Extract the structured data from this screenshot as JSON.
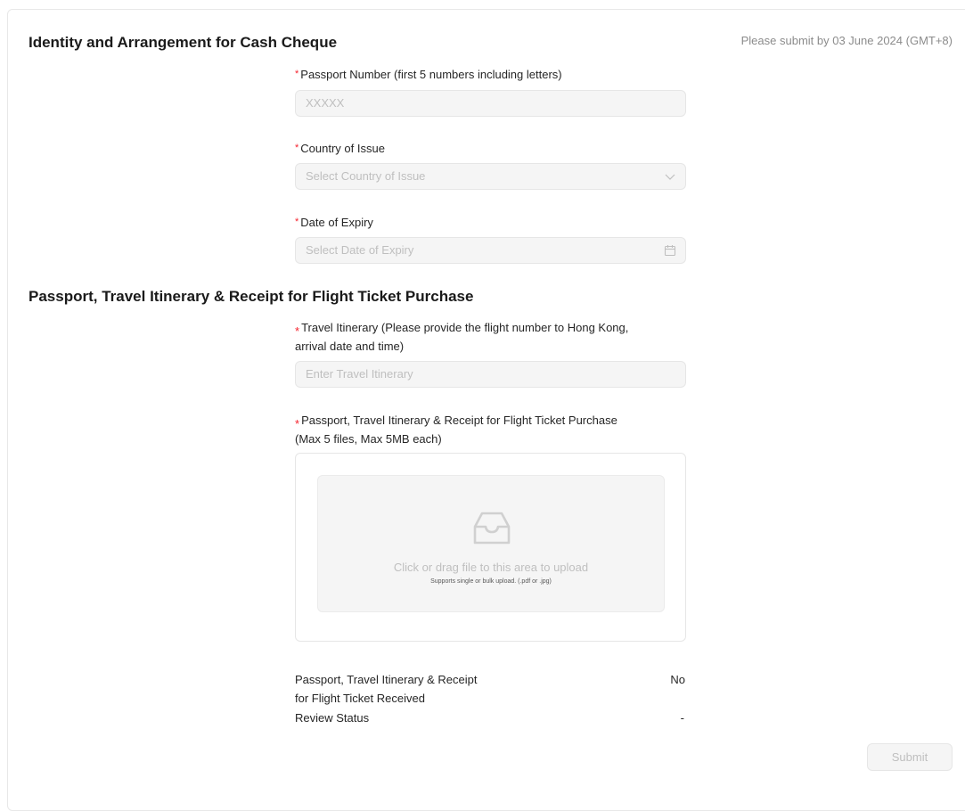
{
  "deadline": "Please submit by 03 June 2024 (GMT+8)",
  "section1": {
    "title": "Identity and Arrangement for Cash Cheque",
    "passport": {
      "label": "Passport Number (first 5 numbers including letters)",
      "placeholder": "XXXXX"
    },
    "country": {
      "label": "Country of Issue",
      "placeholder": "Select Country of Issue"
    },
    "expiry": {
      "label": "Date of Expiry",
      "placeholder": "Select Date of Expiry"
    }
  },
  "section2": {
    "title": "Passport, Travel Itinerary & Receipt for Flight Ticket Purchase",
    "itinerary": {
      "label_line1": "Travel Itinerary (Please provide the flight number to Hong Kong,",
      "label_line2": "arrival date and time)",
      "placeholder": "Enter Travel Itinerary"
    },
    "upload": {
      "label_line1": "Passport, Travel Itinerary & Receipt for Flight Ticket Purchase",
      "label_line2": "(Max 5 files, Max 5MB each)",
      "text": "Click or drag file to this area to upload",
      "hint": "Supports single or bulk upload. (.pdf or .jpg)",
      "icon": "inbox-icon"
    }
  },
  "status": {
    "received_label_line1": "Passport, Travel Itinerary & Receipt",
    "received_label_line2": "for Flight Ticket Received",
    "received_value": "No",
    "review_label": "Review Status",
    "review_value": "-"
  },
  "submit_label": "Submit",
  "colors": {
    "required": "#f5222d",
    "placeholder": "#bfbfbf",
    "input_bg": "#f5f5f5"
  }
}
